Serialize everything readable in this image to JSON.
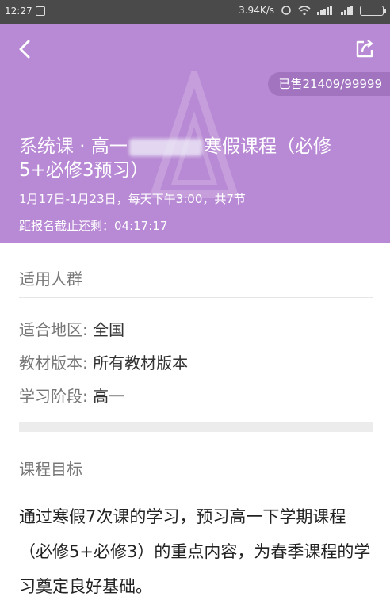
{
  "status_bar": {
    "time": "12:27",
    "speed": "3.94K/s"
  },
  "header": {
    "sold": "已售21409/99999",
    "title_prefix": "系统课 · 高一",
    "title_suffix": "寒假课程（必修5+必修3预习）",
    "schedule": "1月17日-1月23日，每天下午3:00，共7节",
    "deadline": "距报名截止还剩：04:17:17",
    "bg_color": "#b889d4"
  },
  "audience": {
    "title": "适用人群",
    "rows": [
      {
        "key": "适合地区:",
        "value": "全国"
      },
      {
        "key": "教材版本:",
        "value": "所有教材版本"
      },
      {
        "key": "学习阶段:",
        "value": "高一"
      }
    ]
  },
  "goal": {
    "title": "课程目标",
    "text": "通过寒假7次课的学习，预习高一下学期课程（必修5+必修3）的重点内容，为春季课程的学习奠定良好基础。"
  }
}
